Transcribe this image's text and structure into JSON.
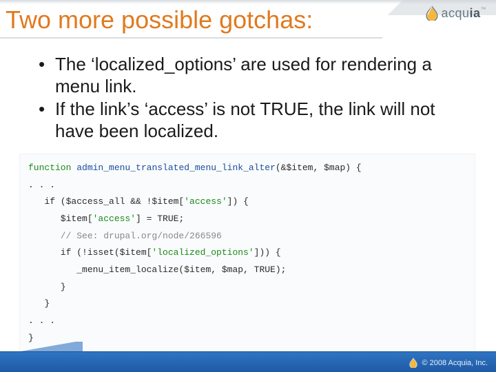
{
  "brand": {
    "name_light": "acqu",
    "name_bold": "ia",
    "tm": "™"
  },
  "title": "Two more possible gotchas:",
  "bullets": [
    "The ‘localized_options’ are used for rendering a menu link.",
    "If the link’s ‘access’ is not TRUE, the link will not have been localized."
  ],
  "code": {
    "l1_kw": "function",
    "l1_fn": " admin_menu_translated_menu_link_alter",
    "l1_rest": "(&$item, $map) {",
    "l2": ". . .",
    "l3_a": "   if ($access_all && !$item[",
    "l3_b": "'access'",
    "l3_c": "]) {",
    "l4_a": "      $item[",
    "l4_b": "'access'",
    "l4_c": "] = TRUE;",
    "l5": "      // See: drupal.org/node/266596",
    "l6_a": "      if (!isset($item[",
    "l6_b": "'localized_options'",
    "l6_c": "])) {",
    "l7": "         _menu_item_localize($item, $map, TRUE);",
    "l8": "      }",
    "l9": "   }",
    "l10": ". . .",
    "l11": "}"
  },
  "footer": {
    "copyright": "© 2008 Acquia, Inc."
  }
}
